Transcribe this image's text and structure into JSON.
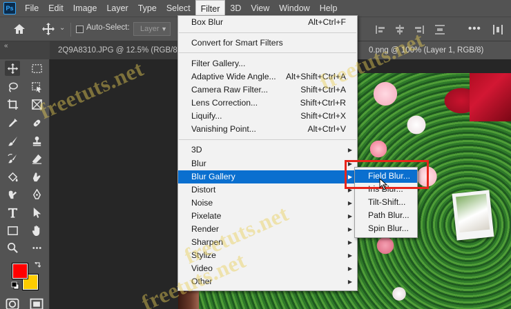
{
  "app": {
    "logo": "Ps"
  },
  "menubar": {
    "items": [
      "File",
      "Edit",
      "Image",
      "Layer",
      "Type",
      "Select",
      "Filter",
      "3D",
      "View",
      "Window",
      "Help"
    ],
    "active": "Filter"
  },
  "options_bar": {
    "auto_select_label": "Auto-Select:",
    "auto_select_value": "Layer",
    "icons": [
      "home-icon",
      "move-icon",
      "align-icons",
      "more-icon"
    ]
  },
  "tabs": [
    {
      "label": "2Q9A8310.JPG @ 12.5% (RGB/8)"
    },
    {
      "label": "0.png @ 100% (Layer 1, RGB/8)"
    }
  ],
  "filter_menu": {
    "items": [
      {
        "label": "Box Blur",
        "shortcut": "Alt+Ctrl+F"
      },
      {
        "label": "Convert for Smart Filters",
        "shortcut": ""
      },
      {
        "label": "Filter Gallery...",
        "shortcut": ""
      },
      {
        "label": "Adaptive Wide Angle...",
        "shortcut": "Alt+Shift+Ctrl+A"
      },
      {
        "label": "Camera Raw Filter...",
        "shortcut": "Shift+Ctrl+A"
      },
      {
        "label": "Lens Correction...",
        "shortcut": "Shift+Ctrl+R"
      },
      {
        "label": "Liquify...",
        "shortcut": "Shift+Ctrl+X"
      },
      {
        "label": "Vanishing Point...",
        "shortcut": "Alt+Ctrl+V"
      },
      {
        "label": "3D",
        "submenu": true
      },
      {
        "label": "Blur",
        "submenu": true
      },
      {
        "label": "Blur Gallery",
        "submenu": true,
        "highlighted": true
      },
      {
        "label": "Distort",
        "submenu": true
      },
      {
        "label": "Noise",
        "submenu": true
      },
      {
        "label": "Pixelate",
        "submenu": true
      },
      {
        "label": "Render",
        "submenu": true
      },
      {
        "label": "Sharpen",
        "submenu": true
      },
      {
        "label": "Stylize",
        "submenu": true
      },
      {
        "label": "Video",
        "submenu": true
      },
      {
        "label": "Other",
        "submenu": true
      }
    ]
  },
  "blur_gallery_submenu": {
    "items": [
      {
        "label": "Field Blur...",
        "highlighted": true
      },
      {
        "label": "Iris Blur..."
      },
      {
        "label": "Tilt-Shift..."
      },
      {
        "label": "Path Blur..."
      },
      {
        "label": "Spin Blur..."
      }
    ]
  },
  "colors": {
    "foreground": "#ff0000",
    "background": "#ffcc00",
    "menu_highlight": "#0a6fcf",
    "annotation": "#e8251b"
  },
  "watermark": "freetuts.net"
}
